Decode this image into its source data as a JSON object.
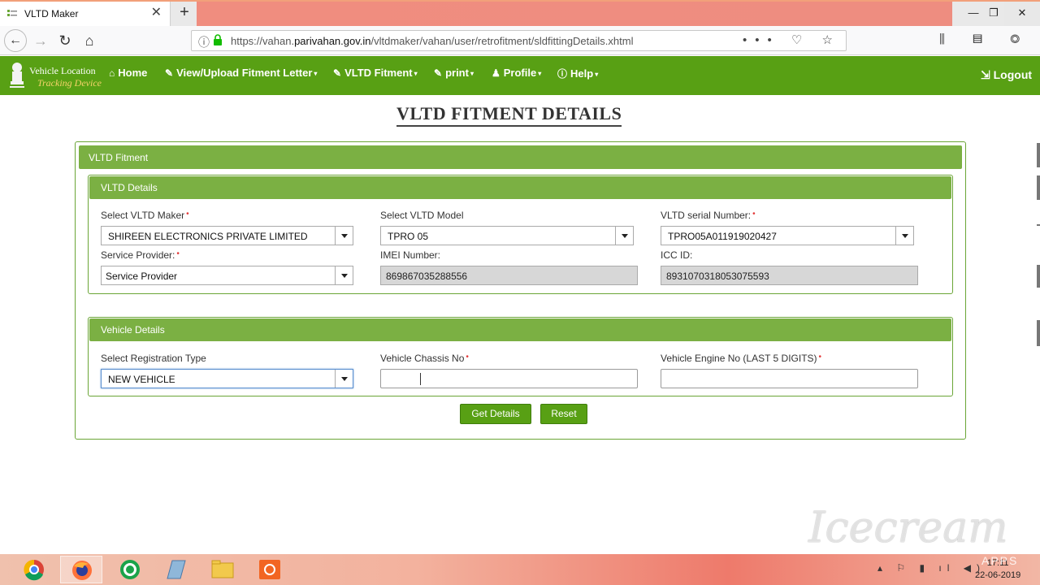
{
  "browser": {
    "tab_title": "VLTD Maker",
    "tab_close": "✕",
    "new_tab": "+",
    "url_prefix": "https://vahan.",
    "url_domain": "parivahan.gov.in",
    "url_path": "/vltdmaker/vahan/user/retrofitment/sldfittingDetails.xhtml",
    "url_actions": "••• ♡ ☆",
    "window_controls": [
      "—",
      "❐",
      "✕"
    ],
    "toolbar_icons": "⫼ ▤ ◎ ≡"
  },
  "app": {
    "logo_line1": "Vehicle Location",
    "logo_line2": "Tracking Device",
    "menu": [
      {
        "icon": "⌂",
        "label": "Home",
        "caret": ""
      },
      {
        "icon": "✎",
        "label": "View/Upload Fitment Letter",
        "caret": "▾"
      },
      {
        "icon": "✎",
        "label": "VLTD Fitment",
        "caret": "▾"
      },
      {
        "icon": "✎",
        "label": "print",
        "caret": "▾"
      },
      {
        "icon": "♟",
        "label": "Profile",
        "caret": "▾"
      },
      {
        "icon": "ⓘ",
        "label": "Help",
        "caret": "▾"
      }
    ],
    "logout_label": "Logout"
  },
  "page": {
    "title": "VLTD FITMENT DETAILS",
    "outer_header": "VLTD Fitment",
    "vltd_details": {
      "header": "VLTD Details",
      "maker_label": "Select VLTD Maker",
      "maker_value": "SHIREEN ELECTRONICS PRIVATE LIMITED",
      "model_label": "Select VLTD Model",
      "model_value": "TPRO 05",
      "serial_label": "VLTD serial Number:",
      "serial_value": "TPRO05A011919020427",
      "provider_label": "Service Provider:",
      "provider_value": "Service Provider",
      "imei_label": "IMEI Number:",
      "imei_value": "869867035288556",
      "icc_label": "ICC ID:",
      "icc_value": "8931070318053075593"
    },
    "vehicle_details": {
      "header": "Vehicle Details",
      "reg_type_label": "Select Registration Type",
      "reg_type_value": "NEW VEHICLE",
      "chassis_label": "Vehicle Chassis No",
      "chassis_value": "",
      "engine_label": "Vehicle Engine No (LAST 5 DIGITS)",
      "engine_value": ""
    },
    "required_mark": "•",
    "get_details_button": "Get Details",
    "reset_button": "Reset"
  },
  "taskbar": {
    "tray_icons": "▴ ⚐ ▮ ıl ◀)",
    "time": "17:11",
    "date": "22-06-2019"
  },
  "watermark": {
    "text": "Icecream",
    "subtext": "APPS"
  },
  "colors": {
    "brand_green": "#58a014",
    "panel_header_green": "#7bb043",
    "required_red": "#e23a3a"
  }
}
